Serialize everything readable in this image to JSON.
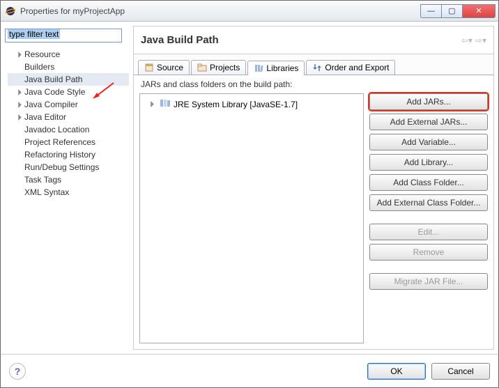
{
  "window": {
    "title": "Properties for myProjectApp"
  },
  "filter": {
    "placeholder": "type filter text"
  },
  "tree": {
    "items": [
      {
        "label": "Resource",
        "expandable": true
      },
      {
        "label": "Builders",
        "expandable": false
      },
      {
        "label": "Java Build Path",
        "expandable": false,
        "selected": true
      },
      {
        "label": "Java Code Style",
        "expandable": true
      },
      {
        "label": "Java Compiler",
        "expandable": true
      },
      {
        "label": "Java Editor",
        "expandable": true
      },
      {
        "label": "Javadoc Location",
        "expandable": false
      },
      {
        "label": "Project References",
        "expandable": false
      },
      {
        "label": "Refactoring History",
        "expandable": false
      },
      {
        "label": "Run/Debug Settings",
        "expandable": false
      },
      {
        "label": "Task Tags",
        "expandable": false
      },
      {
        "label": "XML Syntax",
        "expandable": false
      }
    ]
  },
  "page": {
    "title": "Java Build Path",
    "tabs": [
      {
        "label": "Source"
      },
      {
        "label": "Projects"
      },
      {
        "label": "Libraries",
        "active": true
      },
      {
        "label": "Order and Export"
      }
    ],
    "subheader": "JARs and class folders on the build path:",
    "jarTree": [
      {
        "label": "JRE System Library [JavaSE-1.7]"
      }
    ],
    "buttons": {
      "addJars": "Add JARs...",
      "addExternalJars": "Add External JARs...",
      "addVariable": "Add Variable...",
      "addLibrary": "Add Library...",
      "addClassFolder": "Add Class Folder...",
      "addExternalClassFolder": "Add External Class Folder...",
      "edit": "Edit...",
      "remove": "Remove",
      "migrate": "Migrate JAR File..."
    }
  },
  "footer": {
    "ok": "OK",
    "cancel": "Cancel"
  }
}
